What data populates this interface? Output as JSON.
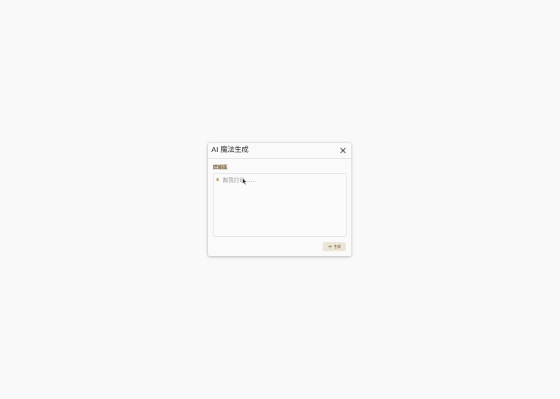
{
  "dialog": {
    "title": "AI 魔法生成",
    "close_icon": "close-icon",
    "field_label": "詳細區",
    "input": {
      "placeholder": "幫我打造……",
      "value": "",
      "leading_icon": "sparkle-icon"
    },
    "generate_button": {
      "icon": "plus-icon",
      "label": "生成"
    }
  },
  "colors": {
    "background": "#f9f9f9",
    "dialog_bg": "#fafafa",
    "label_color": "#6b5633",
    "button_bg": "#ece4d6",
    "button_text": "#5c4a2a"
  }
}
